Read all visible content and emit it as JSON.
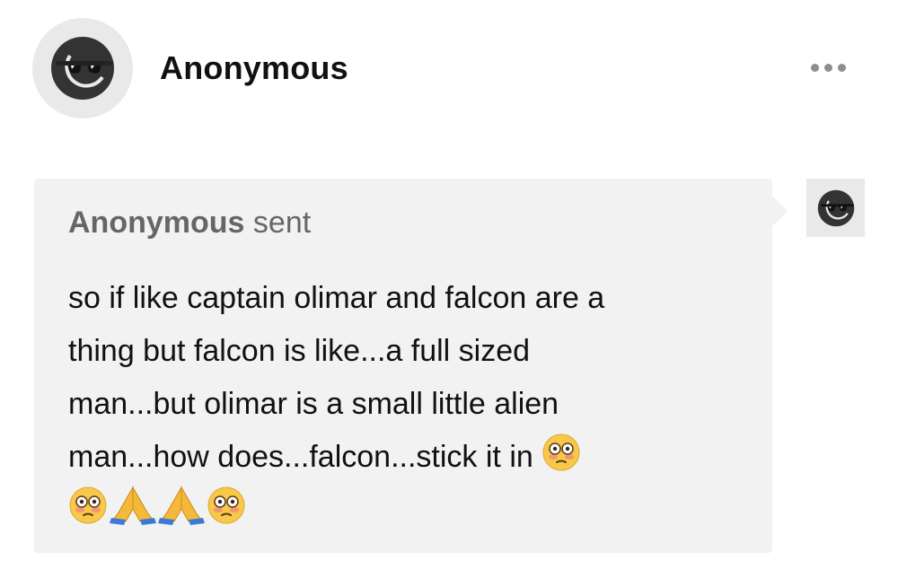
{
  "post": {
    "author": "Anonymous",
    "avatar_icon": "sunglasses-face-icon",
    "more_icon": "more-options-icon"
  },
  "ask": {
    "sender_name": "Anonymous",
    "sender_suffix": "sent",
    "lines": [
      "so if like captain olimar and falcon are a",
      "thing but falcon is like...a full sized",
      "man...but olimar is a small little alien",
      "man...how does...falcon...stick it in"
    ],
    "emoji_line4": [
      "flushed-face-icon"
    ],
    "emoji_line5": [
      "flushed-face-icon",
      "folded-hands-icon",
      "folded-hands-icon",
      "flushed-face-icon"
    ],
    "asker_avatar_icon": "sunglasses-face-icon"
  },
  "colors": {
    "bubble_bg": "#f2f2f2",
    "avatar_bg": "#e9e9e9",
    "icon_dark": "#333333",
    "meta_text": "#666666",
    "body_text": "#111111"
  }
}
